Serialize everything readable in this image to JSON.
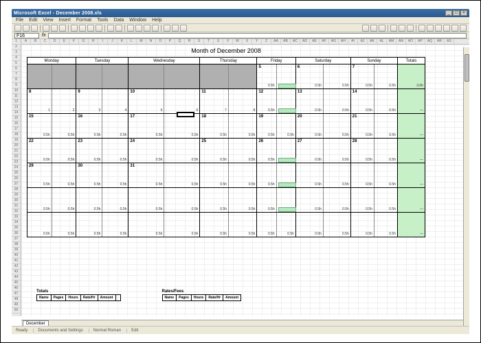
{
  "titlebar": {
    "text": "Microsoft Excel - December 2008.xls"
  },
  "menu": {
    "items": [
      "File",
      "Edit",
      "View",
      "Insert",
      "Format",
      "Tools",
      "Data",
      "Window",
      "Help"
    ]
  },
  "formula": {
    "cellref": "F16",
    "fx": "fx"
  },
  "calendar": {
    "title": "Month of December 2008",
    "days": [
      "Monday",
      "Tuesday",
      "Wednesday",
      "Thursday",
      "Friday",
      "Saturday",
      "Sunday"
    ],
    "summary_head": "Totals",
    "weeks": [
      {
        "grey_count": 4,
        "cells": [
          {
            "d": "",
            "a": "",
            "b": ""
          },
          {
            "d": "",
            "a": "",
            "b": ""
          },
          {
            "d": "",
            "a": "",
            "b": ""
          },
          {
            "d": "",
            "a": "",
            "b": ""
          },
          {
            "d": "5",
            "a": "0.5h",
            "b": "0.5h"
          },
          {
            "d": "6",
            "a": "0.5h",
            "b": "0.5h"
          },
          {
            "d": "7",
            "a": "0.5h",
            "b": "0.5h"
          }
        ],
        "sum": "3.0h",
        "green": 4
      },
      {
        "grey_count": 0,
        "cells": [
          {
            "d": "8",
            "a": "1",
            "b": "2"
          },
          {
            "d": "9",
            "a": "3",
            "b": "4"
          },
          {
            "d": "10",
            "a": "5",
            "b": "6"
          },
          {
            "d": "11",
            "a": "7",
            "b": "8"
          },
          {
            "d": "12",
            "a": "0.5h",
            "b": "0.5h"
          },
          {
            "d": "13",
            "a": "0.5h",
            "b": "0.5h"
          },
          {
            "d": "14",
            "a": "0.5h",
            "b": "0.5h"
          }
        ],
        "sum": "—",
        "green": 4
      },
      {
        "grey_count": 0,
        "cells": [
          {
            "d": "15",
            "a": "0.5h",
            "b": "0.5h"
          },
          {
            "d": "16",
            "a": "0.5h",
            "b": "0.5h"
          },
          {
            "d": "17",
            "a": "0.5h",
            "b": "0.5h"
          },
          {
            "d": "18",
            "a": "0.5h",
            "b": "0.5h"
          },
          {
            "d": "19",
            "a": "0.5h",
            "b": "0.5h"
          },
          {
            "d": "20",
            "a": "0.5h",
            "b": "0.5h"
          },
          {
            "d": "21",
            "a": "0.5h",
            "b": "0.5h"
          }
        ],
        "sum": "—",
        "green": -1
      },
      {
        "grey_count": 0,
        "cells": [
          {
            "d": "22",
            "a": "0.5h",
            "b": "0.5h"
          },
          {
            "d": "23",
            "a": "0.5h",
            "b": "0.5h"
          },
          {
            "d": "24",
            "a": "0.5h",
            "b": "0.5h"
          },
          {
            "d": "25",
            "a": "0.5h",
            "b": "0.5h"
          },
          {
            "d": "26",
            "a": "0.5h",
            "b": "0.5h"
          },
          {
            "d": "27",
            "a": "0.5h",
            "b": "0.5h"
          },
          {
            "d": "28",
            "a": "0.5h",
            "b": "0.5h"
          }
        ],
        "sum": "—",
        "green": 4
      },
      {
        "grey_count": 0,
        "cells": [
          {
            "d": "29",
            "a": "0.5h",
            "b": "0.5h"
          },
          {
            "d": "30",
            "a": "0.5h",
            "b": "0.5h"
          },
          {
            "d": "31",
            "a": "0.5h",
            "b": "0.5h"
          },
          {
            "d": "",
            "a": "0.5h",
            "b": "0.5h"
          },
          {
            "d": "",
            "a": "0.5h",
            "b": "0.5h"
          },
          {
            "d": "",
            "a": "0.5h",
            "b": "0.5h"
          },
          {
            "d": "",
            "a": "0.5h",
            "b": "0.5h"
          }
        ],
        "sum": "—",
        "green": 4
      },
      {
        "grey_count": 0,
        "cells": [
          {
            "d": "",
            "a": "0.5h",
            "b": "0.5h"
          },
          {
            "d": "",
            "a": "0.5h",
            "b": "0.5h"
          },
          {
            "d": "",
            "a": "0.5h",
            "b": "0.5h"
          },
          {
            "d": "",
            "a": "0.5h",
            "b": "0.5h"
          },
          {
            "d": "",
            "a": "0.5h",
            "b": "0.5h"
          },
          {
            "d": "",
            "a": "0.5h",
            "b": "0.5h"
          },
          {
            "d": "",
            "a": "0.5h",
            "b": "0.5h"
          }
        ],
        "sum": "—",
        "green": 4
      },
      {
        "grey_count": 0,
        "cells": [
          {
            "d": "",
            "a": "0.5h",
            "b": "0.5h"
          },
          {
            "d": "",
            "a": "0.5h",
            "b": "0.5h"
          },
          {
            "d": "",
            "a": "0.5h",
            "b": "0.5h"
          },
          {
            "d": "",
            "a": "0.5h",
            "b": "0.5h"
          },
          {
            "d": "",
            "a": "0.5h",
            "b": "0.5h"
          },
          {
            "d": "",
            "a": "0.5h",
            "b": "0.5h"
          },
          {
            "d": "",
            "a": "0.5h",
            "b": "0.5h"
          }
        ],
        "sum": "—",
        "green": -1
      }
    ]
  },
  "footer_left": {
    "label": "Totals",
    "cols": [
      "Name",
      "Pages",
      "Hours",
      "Rate/Hr",
      "Amount",
      ""
    ]
  },
  "footer_right": {
    "label": "Rates/Fees",
    "cols": [
      "Name",
      "Pages",
      "Hours",
      "Rate/Hr",
      "Amount"
    ]
  },
  "status": {
    "ready": "Ready",
    "path": "Documents and Settings",
    "encoding": "Normal Roman",
    "mode": "Edit"
  },
  "tabs": {
    "sheet1": "December"
  }
}
